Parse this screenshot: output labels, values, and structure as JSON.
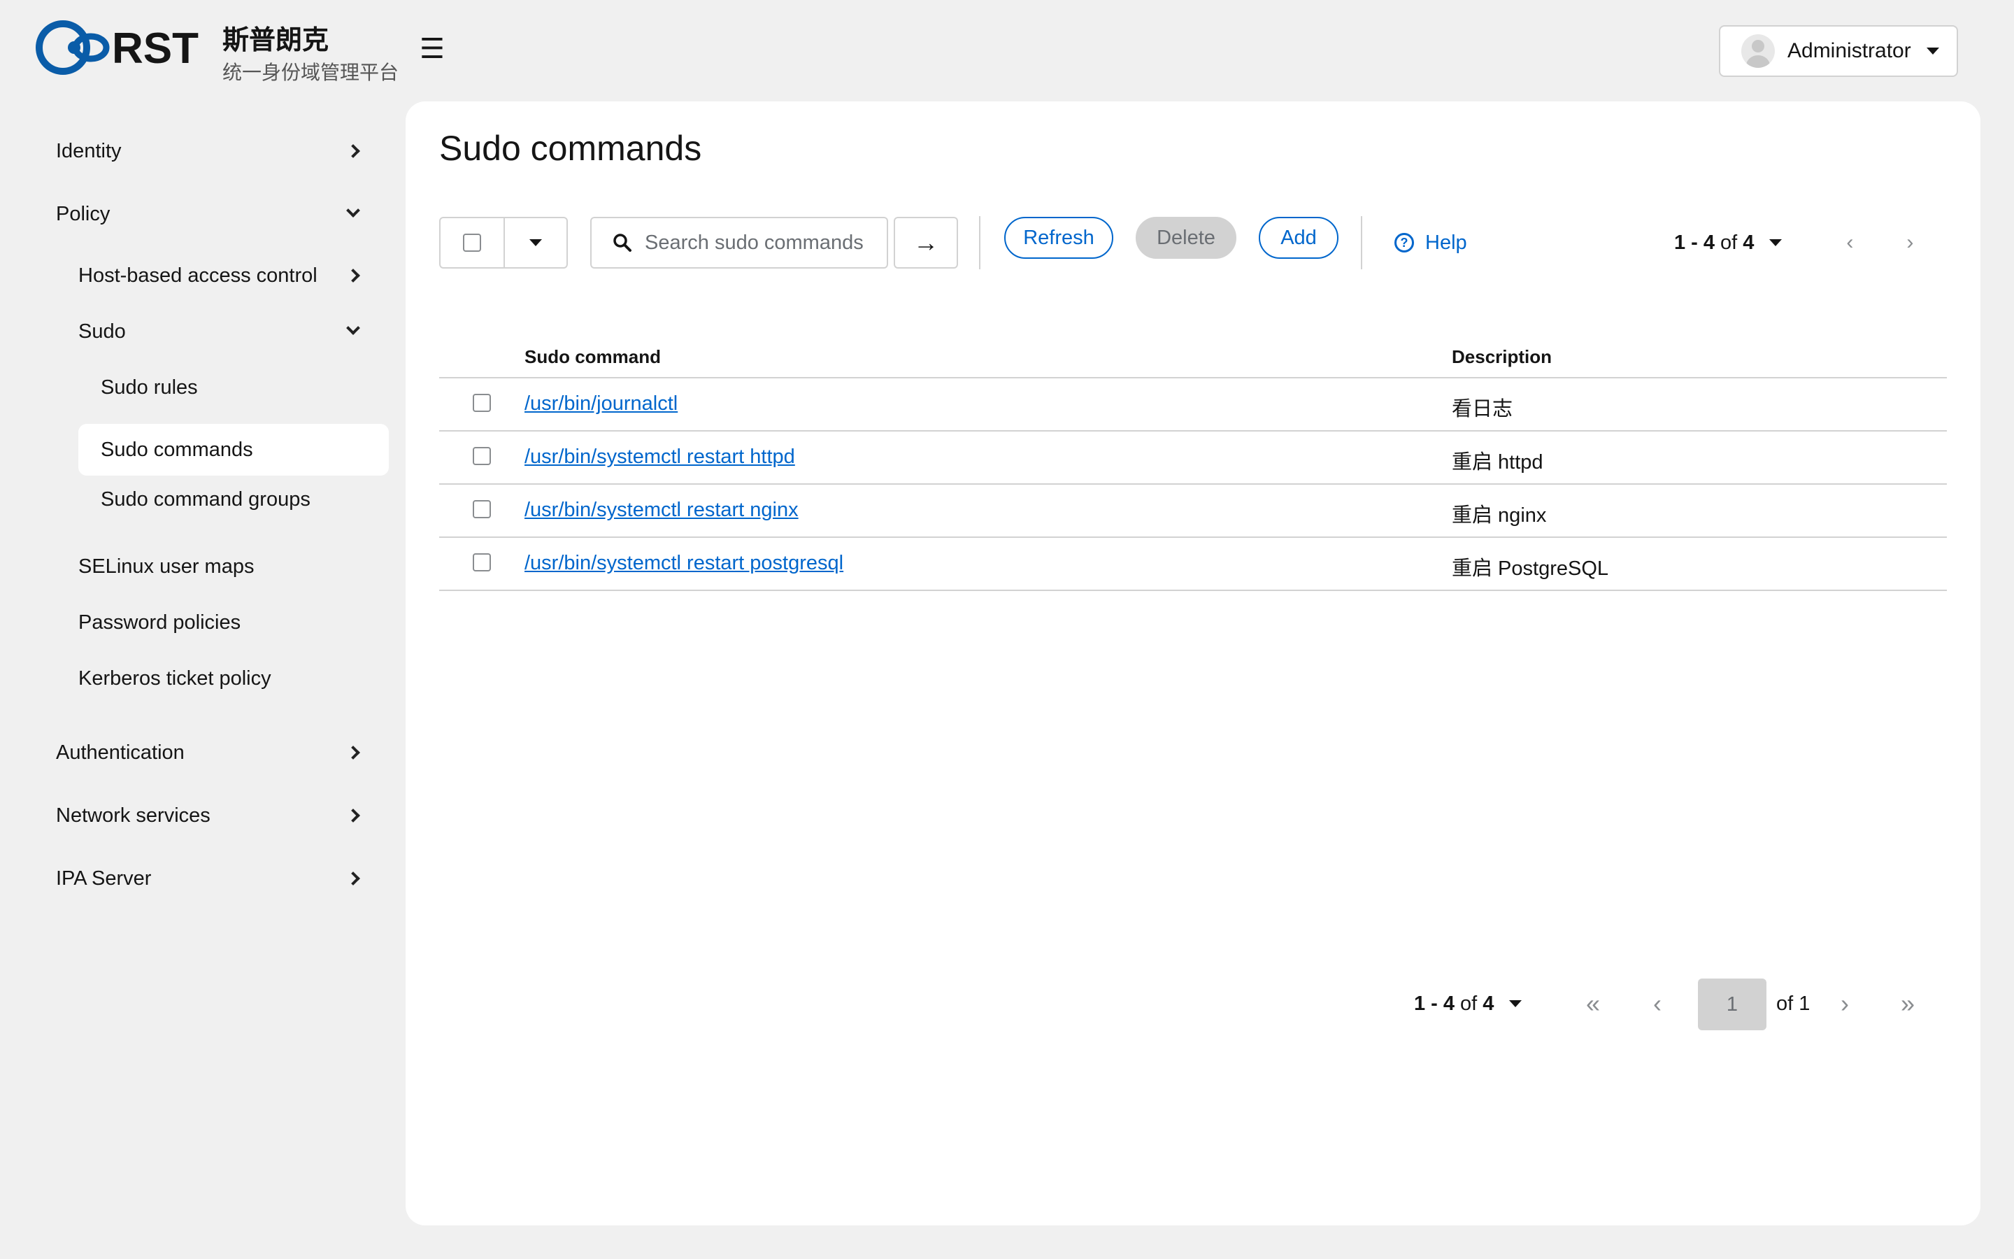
{
  "brand": {
    "logo_text": "RST",
    "name": "斯普朗克",
    "subtitle": "统一身份域管理平台"
  },
  "header": {
    "menu_icon": "☰",
    "user": "Administrator"
  },
  "sidebar": {
    "items": [
      {
        "label": "Identity"
      },
      {
        "label": "Policy"
      },
      {
        "label": "Host-based access control"
      },
      {
        "label": "Sudo"
      },
      {
        "label": "Sudo rules"
      },
      {
        "label": "Sudo commands"
      },
      {
        "label": "Sudo command groups"
      },
      {
        "label": "SELinux user maps"
      },
      {
        "label": "Password policies"
      },
      {
        "label": "Kerberos ticket policy"
      },
      {
        "label": "Authentication"
      },
      {
        "label": "Network services"
      },
      {
        "label": "IPA Server"
      }
    ]
  },
  "main": {
    "title": "Sudo commands",
    "search_placeholder": "Search sudo commands",
    "buttons": {
      "refresh": "Refresh",
      "delete": "Delete",
      "add": "Add",
      "help": "Help",
      "help_glyph": "?",
      "go_arrow": "→"
    },
    "pagination_top": {
      "range": "1 - 4",
      "of": "of",
      "total": "4",
      "prev": "‹",
      "next": "›"
    },
    "columns": {
      "command": "Sudo command",
      "description": "Description"
    },
    "rows": [
      {
        "command": "/usr/bin/journalctl",
        "description": "看日志"
      },
      {
        "command": "/usr/bin/systemctl restart httpd",
        "description": "重启 httpd"
      },
      {
        "command": "/usr/bin/systemctl restart nginx",
        "description": "重启 nginx"
      },
      {
        "command": "/usr/bin/systemctl restart postgresql",
        "description": "重启 PostgreSQL"
      }
    ],
    "pagination_bottom": {
      "range": "1 - 4",
      "of": "of",
      "total": "4",
      "first": "«",
      "prev": "‹",
      "page": "1",
      "of_pages": "of 1",
      "next": "›",
      "last": "»"
    }
  },
  "colors": {
    "accent": "#0066cc",
    "logo": "#0a5ca8",
    "background": "#f0f0f0"
  }
}
